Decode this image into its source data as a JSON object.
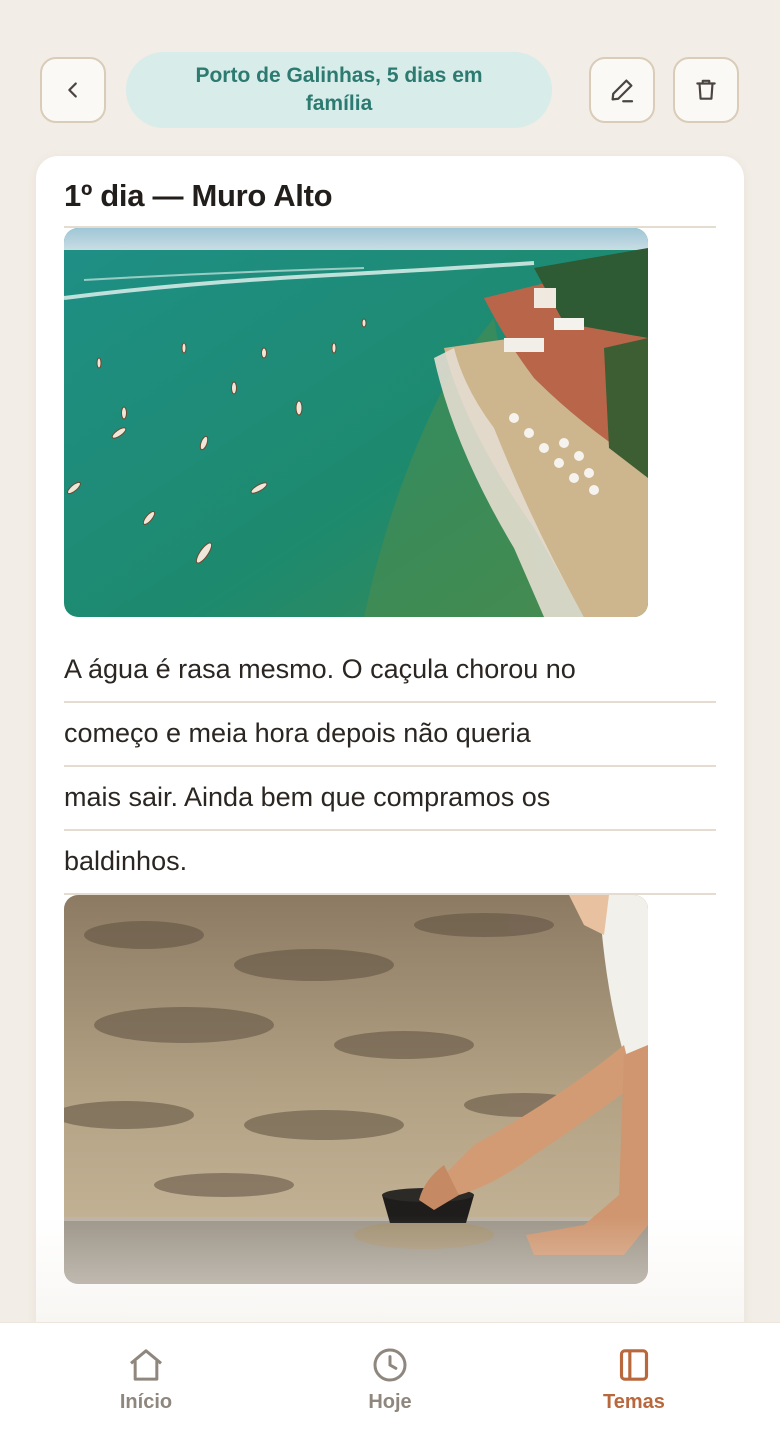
{
  "header": {
    "title": "Porto de Galinhas, 5 dias em família",
    "back_icon": "chevron-left-icon",
    "edit_icon": "pencil-icon",
    "delete_icon": "trash-icon"
  },
  "entry": {
    "title": "1º dia — Muro Alto",
    "text_lines": [
      "A água é rasa mesmo. O caçula chorou no",
      "começo e meia hora depois não queria",
      "mais sair. Ainda bem que compramos os",
      "baldinhos."
    ]
  },
  "nav": {
    "items": [
      {
        "label": "Início",
        "icon": "home-icon"
      },
      {
        "label": "Hoje",
        "icon": "clock-icon"
      },
      {
        "label": "Temas",
        "icon": "book-icon"
      }
    ],
    "active_color": "#b8683c",
    "inactive_color": "#8f877e"
  },
  "colors": {
    "accent_teal": "#2c7a70",
    "pill_bg": "#d8ecea",
    "background": "#f2ede6"
  }
}
